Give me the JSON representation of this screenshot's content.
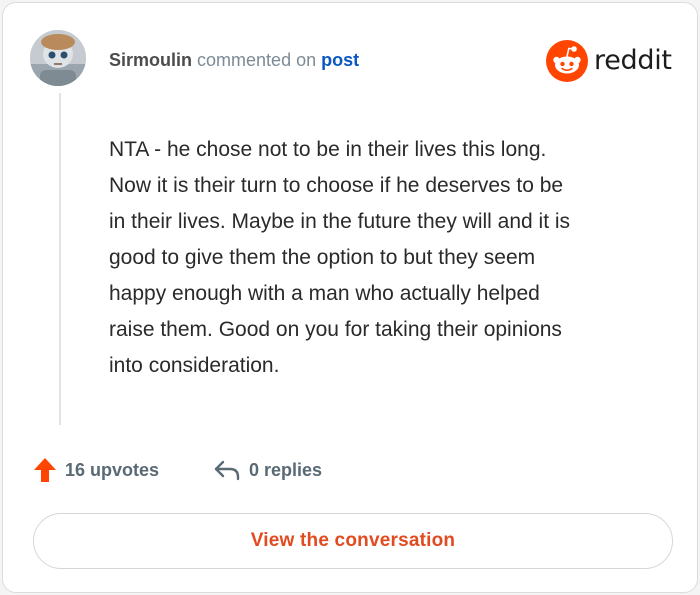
{
  "comment": {
    "username": "Sirmoulin",
    "action_text": "commented on",
    "target_link": "post",
    "body": "NTA - he chose not to be in their lives this long.\nNow it is their turn to choose if he deserves to be\nin their lives. Maybe in the future they will and it is\ngood to give them the option to but they seem\nhappy enough with a man who actually helped\nraise them. Good on you for taking their opinions\ninto consideration."
  },
  "brand": {
    "name": "reddit",
    "icon": "reddit-snoo-icon",
    "color": "#ff4500"
  },
  "stats": {
    "upvotes_label": "16 upvotes",
    "upvote_icon": "arrow-up-icon",
    "replies_label": "0 replies",
    "reply_icon": "reply-icon"
  },
  "cta": {
    "label": "View the conversation",
    "color": "#e24a1f"
  },
  "colors": {
    "link": "#0a57c2",
    "upvote": "#ff4500",
    "muted": "#5a6a75"
  }
}
